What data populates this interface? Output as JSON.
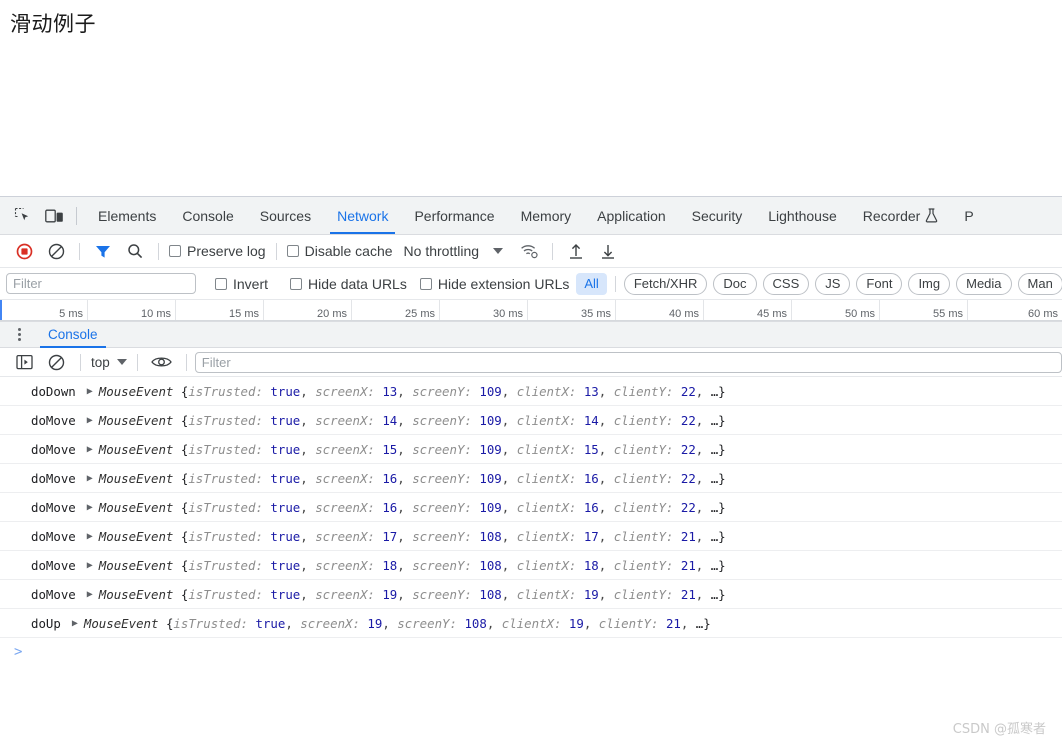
{
  "webpage": {
    "heading": "滑动例子"
  },
  "devtools": {
    "main_tabs": [
      {
        "label": "Elements",
        "selected": false
      },
      {
        "label": "Console",
        "selected": false
      },
      {
        "label": "Sources",
        "selected": false
      },
      {
        "label": "Network",
        "selected": true
      },
      {
        "label": "Performance",
        "selected": false
      },
      {
        "label": "Memory",
        "selected": false
      },
      {
        "label": "Application",
        "selected": false
      },
      {
        "label": "Security",
        "selected": false
      },
      {
        "label": "Lighthouse",
        "selected": false
      },
      {
        "label": "Recorder",
        "selected": false
      },
      {
        "label": "P",
        "selected": false
      }
    ],
    "icons": {
      "inspect": "inspect-element-icon",
      "device": "device-toolbar-icon",
      "record": "record-network-icon",
      "clear": "clear-network-icon",
      "filter": "filter-icon",
      "search": "search-icon",
      "throttle_settings": "network-conditions-icon",
      "import_har": "import-har-icon",
      "export_har": "export-har-icon"
    },
    "network_toolbar": {
      "preserve_log": "Preserve log",
      "disable_cache": "Disable cache",
      "throttling": "No throttling"
    },
    "filter_bar": {
      "filter_placeholder": "Filter",
      "filter_value": "",
      "invert": "Invert",
      "hide_data_urls": "Hide data URLs",
      "hide_extension_urls": "Hide extension URLs",
      "types": [
        "All",
        "Fetch/XHR",
        "Doc",
        "CSS",
        "JS",
        "Font",
        "Img",
        "Media",
        "Man"
      ],
      "selected_type": "All"
    },
    "timeline": {
      "ticks": [
        "5 ms",
        "10 ms",
        "15 ms",
        "20 ms",
        "25 ms",
        "30 ms",
        "35 ms",
        "40 ms",
        "45 ms",
        "50 ms",
        "55 ms",
        "60 ms"
      ]
    },
    "drawer": {
      "tab": "Console",
      "toolbar": {
        "context": "top",
        "filter_placeholder": "Filter",
        "filter_value": "",
        "sidebar_icon": "console-sidebar-icon",
        "clear_icon": "clear-console-icon",
        "eye_icon": "live-expression-icon"
      },
      "messages": [
        {
          "label": "doDown",
          "type": "MouseEvent",
          "isTrusted": "true",
          "screenX": "13",
          "screenY": "109",
          "clientX": "13",
          "clientY": "22"
        },
        {
          "label": "doMove",
          "type": "MouseEvent",
          "isTrusted": "true",
          "screenX": "14",
          "screenY": "109",
          "clientX": "14",
          "clientY": "22"
        },
        {
          "label": "doMove",
          "type": "MouseEvent",
          "isTrusted": "true",
          "screenX": "15",
          "screenY": "109",
          "clientX": "15",
          "clientY": "22"
        },
        {
          "label": "doMove",
          "type": "MouseEvent",
          "isTrusted": "true",
          "screenX": "16",
          "screenY": "109",
          "clientX": "16",
          "clientY": "22"
        },
        {
          "label": "doMove",
          "type": "MouseEvent",
          "isTrusted": "true",
          "screenX": "16",
          "screenY": "109",
          "clientX": "16",
          "clientY": "22"
        },
        {
          "label": "doMove",
          "type": "MouseEvent",
          "isTrusted": "true",
          "screenX": "17",
          "screenY": "108",
          "clientX": "17",
          "clientY": "21"
        },
        {
          "label": "doMove",
          "type": "MouseEvent",
          "isTrusted": "true",
          "screenX": "18",
          "screenY": "108",
          "clientX": "18",
          "clientY": "21"
        },
        {
          "label": "doMove",
          "type": "MouseEvent",
          "isTrusted": "true",
          "screenX": "19",
          "screenY": "108",
          "clientX": "19",
          "clientY": "21"
        },
        {
          "label": "doUp",
          "type": "MouseEvent",
          "isTrusted": "true",
          "screenX": "19",
          "screenY": "108",
          "clientX": "19",
          "clientY": "21"
        }
      ],
      "field_names": {
        "isTrusted": "isTrusted:",
        "screenX": "screenX:",
        "screenY": "screenY:",
        "clientX": "clientX:",
        "clientY": "clientY:",
        "ellipsis": "…}"
      },
      "prompt": ">"
    }
  },
  "watermark": "CSDN @孤寒者",
  "colors": {
    "accent": "#1a73e8",
    "toolbar_bg": "#f1f3f4",
    "record_red": "#d93025",
    "filter_blue": "#1a73e8",
    "chip_selected_bg": "#d7e6fb",
    "console_number": "#1a1aa6",
    "console_key": "#8d8d8d"
  }
}
